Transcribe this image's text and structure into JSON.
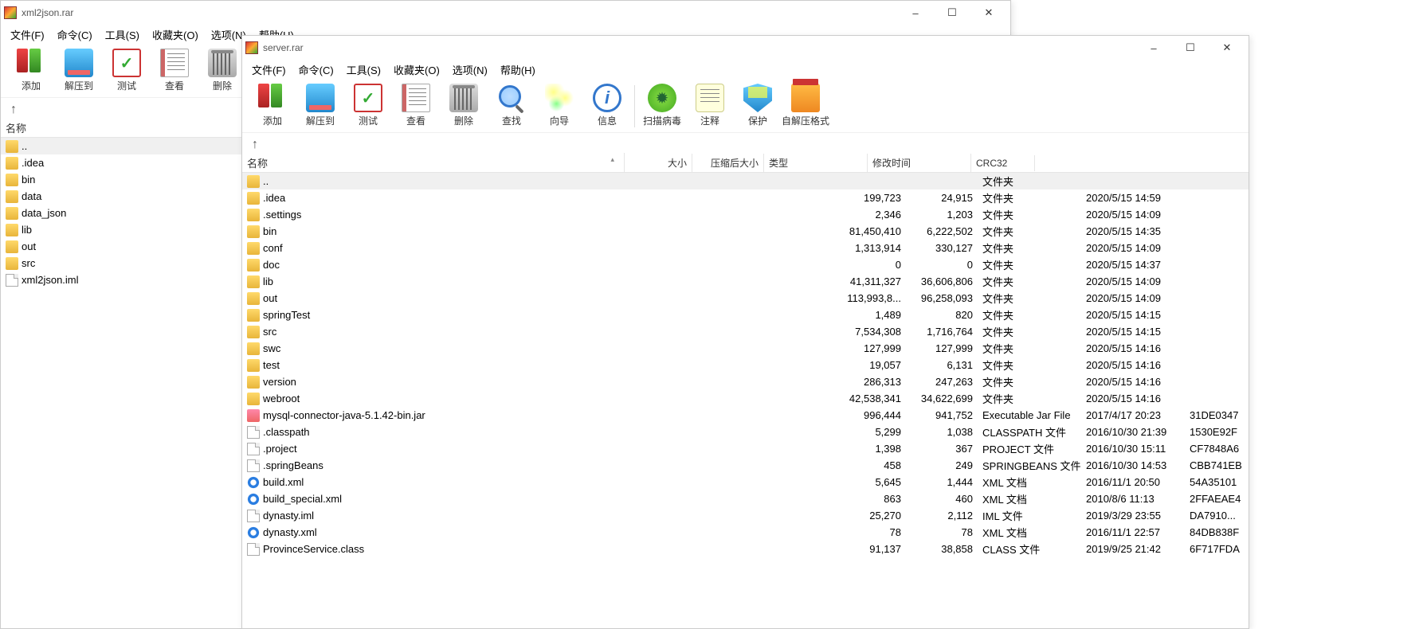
{
  "win1": {
    "title": "xml2json.rar",
    "menu": [
      "文件(F)",
      "命令(C)",
      "工具(S)",
      "收藏夹(O)",
      "选项(N)",
      "帮助(H)"
    ],
    "toolbar": [
      {
        "label": "添加",
        "icon": "add"
      },
      {
        "label": "解压到",
        "icon": "extract"
      },
      {
        "label": "测试",
        "icon": "test"
      },
      {
        "label": "查看",
        "icon": "view"
      },
      {
        "label": "删除",
        "icon": "del"
      }
    ],
    "header": {
      "name": "名称"
    },
    "rows": [
      {
        "name": "..",
        "type": "folder",
        "sel": true
      },
      {
        "name": ".idea",
        "type": "folder"
      },
      {
        "name": "bin",
        "type": "folder"
      },
      {
        "name": "data",
        "type": "folder"
      },
      {
        "name": "data_json",
        "type": "folder"
      },
      {
        "name": "lib",
        "type": "folder"
      },
      {
        "name": "out",
        "type": "folder"
      },
      {
        "name": "src",
        "type": "folder"
      },
      {
        "name": "xml2json.iml",
        "type": "file"
      }
    ]
  },
  "win2": {
    "title": "server.rar",
    "menu": [
      "文件(F)",
      "命令(C)",
      "工具(S)",
      "收藏夹(O)",
      "选项(N)",
      "帮助(H)"
    ],
    "toolbar": [
      {
        "label": "添加",
        "icon": "add"
      },
      {
        "label": "解压到",
        "icon": "extract"
      },
      {
        "label": "测试",
        "icon": "test"
      },
      {
        "label": "查看",
        "icon": "view"
      },
      {
        "label": "删除",
        "icon": "del"
      },
      {
        "label": "查找",
        "icon": "find"
      },
      {
        "label": "向导",
        "icon": "wiz"
      },
      {
        "label": "信息",
        "icon": "info"
      },
      {
        "sep": true
      },
      {
        "label": "扫描病毒",
        "icon": "virus"
      },
      {
        "label": "注释",
        "icon": "comment"
      },
      {
        "label": "保护",
        "icon": "protect"
      },
      {
        "label": "自解压格式",
        "icon": "sfx"
      }
    ],
    "header": {
      "name": "名称",
      "size": "大小",
      "packed": "压缩后大小",
      "ftype": "类型",
      "mod": "修改时间",
      "crc": "CRC32"
    },
    "rows": [
      {
        "name": "..",
        "ftype": "文件夹",
        "type": "folder",
        "sel": true
      },
      {
        "name": ".idea",
        "size": "199,723",
        "packed": "24,915",
        "ftype": "文件夹",
        "mod": "2020/5/15 14:59",
        "type": "folder"
      },
      {
        "name": ".settings",
        "size": "2,346",
        "packed": "1,203",
        "ftype": "文件夹",
        "mod": "2020/5/15 14:09",
        "type": "folder"
      },
      {
        "name": "bin",
        "size": "81,450,410",
        "packed": "6,222,502",
        "ftype": "文件夹",
        "mod": "2020/5/15 14:35",
        "type": "folder"
      },
      {
        "name": "conf",
        "size": "1,313,914",
        "packed": "330,127",
        "ftype": "文件夹",
        "mod": "2020/5/15 14:09",
        "type": "folder"
      },
      {
        "name": "doc",
        "size": "0",
        "packed": "0",
        "ftype": "文件夹",
        "mod": "2020/5/15 14:37",
        "type": "folder"
      },
      {
        "name": "lib",
        "size": "41,311,327",
        "packed": "36,606,806",
        "ftype": "文件夹",
        "mod": "2020/5/15 14:09",
        "type": "folder"
      },
      {
        "name": "out",
        "size": "113,993,8...",
        "packed": "96,258,093",
        "ftype": "文件夹",
        "mod": "2020/5/15 14:09",
        "type": "folder"
      },
      {
        "name": "springTest",
        "size": "1,489",
        "packed": "820",
        "ftype": "文件夹",
        "mod": "2020/5/15 14:15",
        "type": "folder"
      },
      {
        "name": "src",
        "size": "7,534,308",
        "packed": "1,716,764",
        "ftype": "文件夹",
        "mod": "2020/5/15 14:15",
        "type": "folder"
      },
      {
        "name": "swc",
        "size": "127,999",
        "packed": "127,999",
        "ftype": "文件夹",
        "mod": "2020/5/15 14:16",
        "type": "folder"
      },
      {
        "name": "test",
        "size": "19,057",
        "packed": "6,131",
        "ftype": "文件夹",
        "mod": "2020/5/15 14:16",
        "type": "folder"
      },
      {
        "name": "version",
        "size": "286,313",
        "packed": "247,263",
        "ftype": "文件夹",
        "mod": "2020/5/15 14:16",
        "type": "folder"
      },
      {
        "name": "webroot",
        "size": "42,538,341",
        "packed": "34,622,699",
        "ftype": "文件夹",
        "mod": "2020/5/15 14:16",
        "type": "folder"
      },
      {
        "name": "mysql-connector-java-5.1.42-bin.jar",
        "size": "996,444",
        "packed": "941,752",
        "ftype": "Executable Jar File",
        "mod": "2017/4/17 20:23",
        "crc": "31DE0347",
        "type": "jar"
      },
      {
        "name": ".classpath",
        "size": "5,299",
        "packed": "1,038",
        "ftype": "CLASSPATH 文件",
        "mod": "2016/10/30 21:39",
        "crc": "1530E92F",
        "type": "file"
      },
      {
        "name": ".project",
        "size": "1,398",
        "packed": "367",
        "ftype": "PROJECT 文件",
        "mod": "2016/10/30 15:11",
        "crc": "CF7848A6",
        "type": "file"
      },
      {
        "name": ".springBeans",
        "size": "458",
        "packed": "249",
        "ftype": "SPRINGBEANS 文件",
        "mod": "2016/10/30 14:53",
        "crc": "CBB741EB",
        "type": "file"
      },
      {
        "name": "build.xml",
        "size": "5,645",
        "packed": "1,444",
        "ftype": "XML 文档",
        "mod": "2016/11/1 20:50",
        "crc": "54A35101",
        "type": "ie"
      },
      {
        "name": "build_special.xml",
        "size": "863",
        "packed": "460",
        "ftype": "XML 文档",
        "mod": "2010/8/6 11:13",
        "crc": "2FFAEAE4",
        "type": "ie"
      },
      {
        "name": "dynasty.iml",
        "size": "25,270",
        "packed": "2,112",
        "ftype": "IML 文件",
        "mod": "2019/3/29 23:55",
        "crc": "DA7910...",
        "type": "file"
      },
      {
        "name": "dynasty.xml",
        "size": "78",
        "packed": "78",
        "ftype": "XML 文档",
        "mod": "2016/11/1 22:57",
        "crc": "84DB838F",
        "type": "ie"
      },
      {
        "name": "ProvinceService.class",
        "size": "91,137",
        "packed": "38,858",
        "ftype": "CLASS 文件",
        "mod": "2019/9/25 21:42",
        "crc": "6F717FDA",
        "type": "file"
      }
    ]
  }
}
